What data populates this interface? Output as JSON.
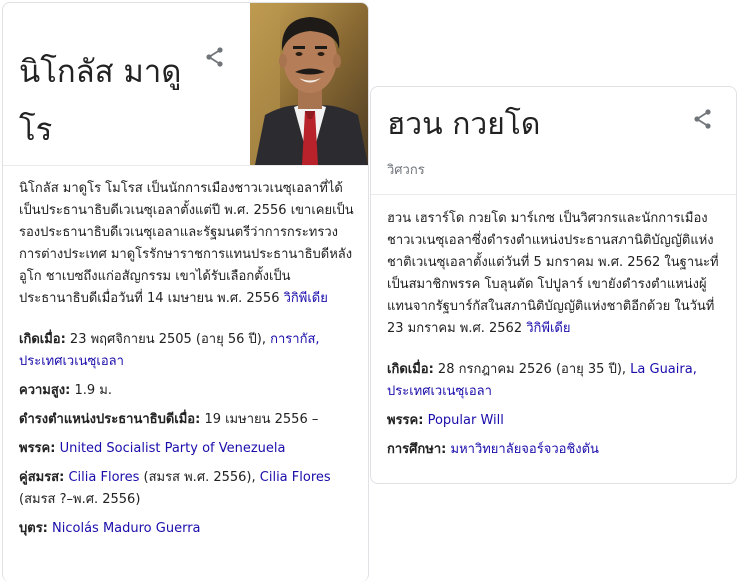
{
  "left_panel": {
    "title": "นิโกลัส มาดูโร",
    "description": "นิโกลัส มาดูโร โมโรส เป็นนักการเมืองชาวเวเนซุเอลาที่ได้เป็นประธานาธิบดีเวเนซุเอลาตั้งแต่ปี พ.ศ. 2556 เขาเคยเป็นรองประธานาธิบดีเวเนซุเอลาและรัฐมนตรีว่าการกระทรวงการต่างประเทศ มาดูโรรักษาราชการแทนประธานาธิบดีหลังอูโก ชาเบซถึงแก่อสัญกรรม เขาได้รับเลือกตั้งเป็นประธานาธิบดีเมื่อวันที่ 14 เมษายน พ.ศ. 2556",
    "wiki_link": "วิกิพีเดีย",
    "facts": {
      "born": {
        "label": "เกิดเมื่อ:",
        "value": "23 พฤศจิกายน 2505 (อายุ 56 ปี), ",
        "link": "การากัส, ประเทศเวเนซุเอลา"
      },
      "height": {
        "label": "ความสูง:",
        "value": "1.9 ม."
      },
      "office": {
        "label": "ดำรงตำแหน่งประธานาธิบดีเมื่อ:",
        "value": "19 เมษายน 2556 –"
      },
      "party": {
        "label": "พรรค:",
        "link": "United Socialist Party of Venezuela"
      },
      "spouse": {
        "label": "คู่สมรส:",
        "link1": "Cilia Flores",
        "value1": " (สมรส พ.ศ. 2556), ",
        "link2": "Cilia Flores",
        "value2": " (สมรส ?–พ.ศ. 2556)"
      },
      "children": {
        "label": "บุตร:",
        "link": "Nicolás Maduro Guerra"
      }
    },
    "share_icon": "share-icon",
    "photo_alt": "portrait-photo"
  },
  "right_panel": {
    "title": "ฮวน กวยโด",
    "subtitle": "วิศวกร",
    "description": "ฮวน เฮราร์โด กวยโด มาร์เกซ เป็นวิศวกรและนักการเมืองชาวเวเนซุเอลาซึ่งดำรงตำแหน่งประธานสภานิติบัญญัติแห่งชาติเวเนซุเอลาตั้งแต่วันที่ 5 มกราคม พ.ศ. 2562 ในฐานะที่เป็นสมาชิกพรรค โบลุนตัด โปปูลาร์ เขายังดำรงตำแหน่งผู้แทนจากรัฐบาร์กัสในสภานิติบัญญัติแห่งชาติอีกด้วย ในวันที่ 23 มกราคม พ.ศ. 2562",
    "wiki_link": "วิกิพีเดีย",
    "facts": {
      "born": {
        "label": "เกิดเมื่อ:",
        "value": "28 กรกฎาคม 2526 (อายุ 35 ปี), ",
        "link": "La Guaira, ประเทศเวเนซุเอลา"
      },
      "party": {
        "label": "พรรค:",
        "link": "Popular Will"
      },
      "education": {
        "label": "การศึกษา:",
        "link": "มหาวิทยาลัยจอร์จวอชิงตัน"
      }
    },
    "share_icon": "share-icon"
  },
  "colors": {
    "link": "#1a0dab",
    "border": "#dfe1e5",
    "text": "#222222",
    "muted": "#70757a"
  }
}
